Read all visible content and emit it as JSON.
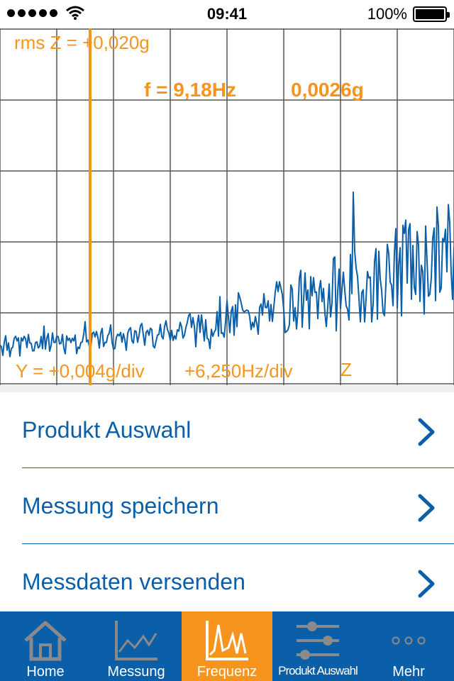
{
  "status_bar": {
    "time": "09:41",
    "battery": "100%",
    "battery_level": 1.0
  },
  "spectrum": {
    "rms_label": "rms Z = +0,020g",
    "frequency_label": "f = 9,18Hz",
    "amplitude_label": "0,0026g",
    "y_scale_label": "Y = +0,004g/div",
    "x_scale_label": "+6,250Hz/div",
    "axis_label": "Z",
    "colors": {
      "trace": "#0a5fa8",
      "cursor": "#f7941d",
      "grid": "#555555"
    }
  },
  "menu": {
    "items": [
      {
        "label": "Produkt Auswahl"
      },
      {
        "label": "Messung speichern"
      },
      {
        "label": "Messdaten versenden"
      }
    ]
  },
  "tabbar": {
    "tabs": [
      {
        "label": "Home",
        "icon": "house-icon",
        "active": false
      },
      {
        "label": "Messung",
        "icon": "line-chart-icon",
        "active": false
      },
      {
        "label": "Frequenz",
        "icon": "spectrum-icon",
        "active": true
      },
      {
        "label": "Produkt Auswahl",
        "icon": "sliders-icon",
        "active": false
      },
      {
        "label": "Mehr",
        "icon": "more-dots-icon",
        "active": false
      }
    ],
    "colors": {
      "background": "#0a5fa8",
      "active": "#f7941d"
    }
  }
}
